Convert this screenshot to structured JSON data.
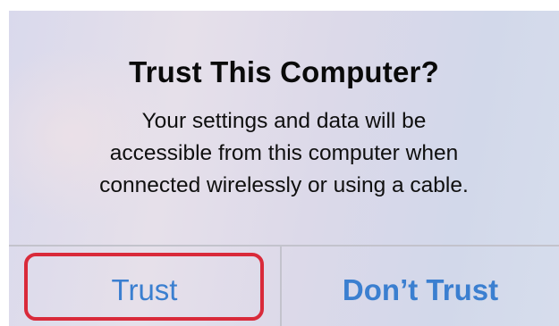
{
  "dialog": {
    "title": "Trust This Computer?",
    "message_lines": [
      "Your settings and data will be",
      "accessible from this computer when",
      "connected wirelessly or using a cable."
    ],
    "buttons": {
      "trust_label": "Trust",
      "dont_trust_label": "Don’t Trust"
    }
  },
  "colors": {
    "button_text": "#3b7fd0",
    "highlight_border": "#d92a3a",
    "title_text": "#0a0a0a"
  }
}
